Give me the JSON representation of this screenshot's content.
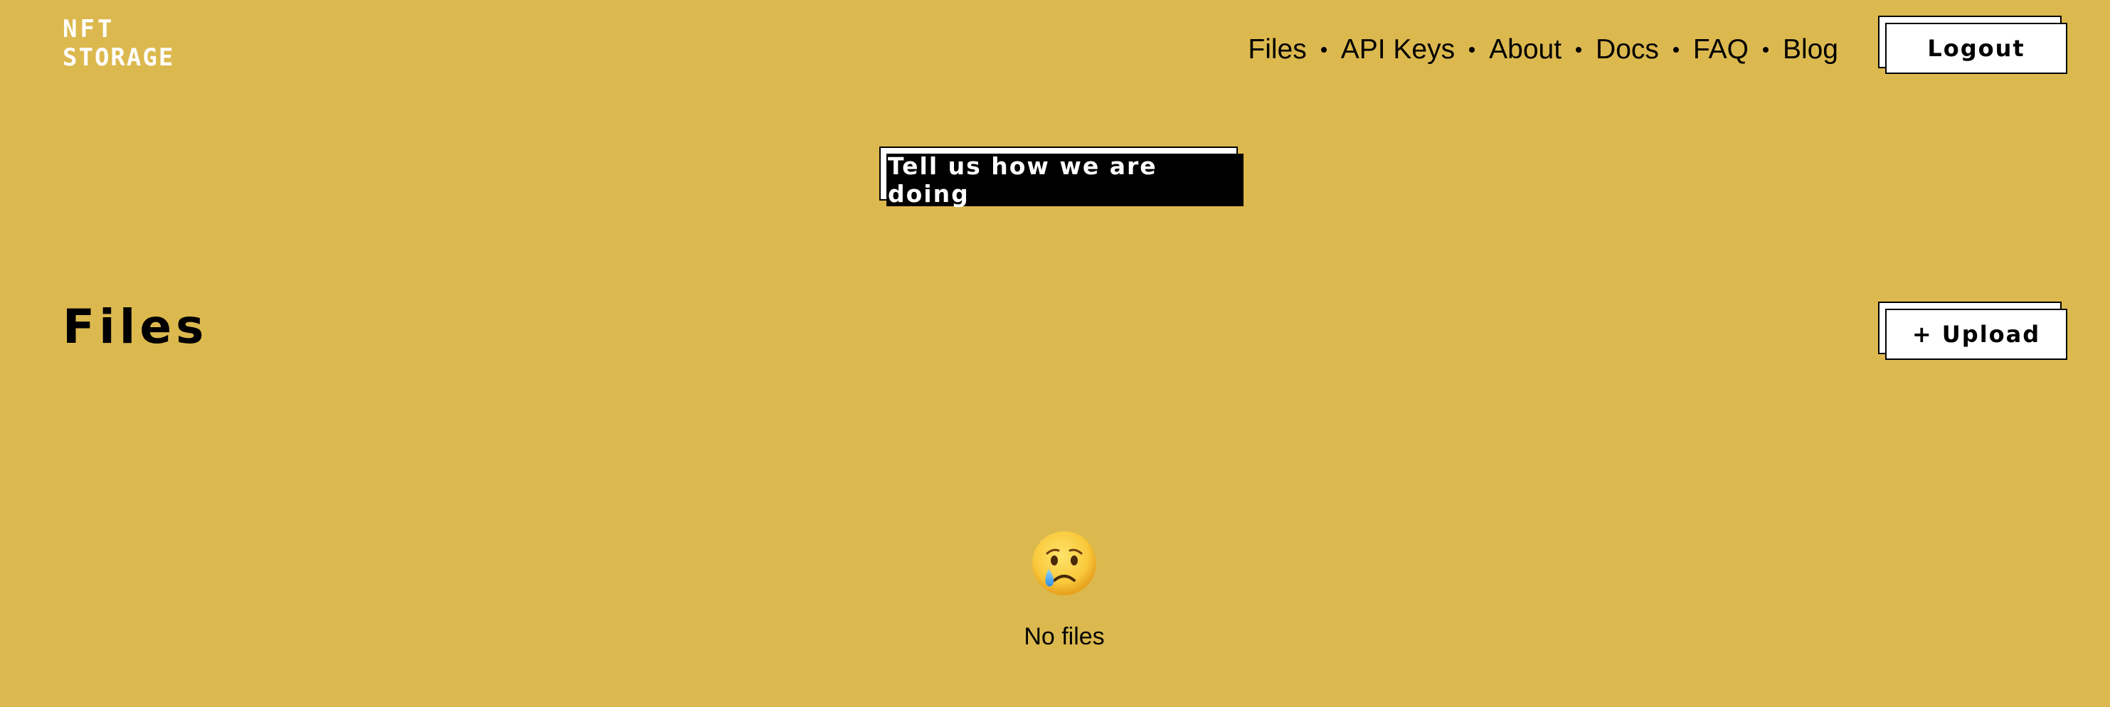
{
  "logo": {
    "line1": "NFT",
    "line2": "STORAGE"
  },
  "nav": {
    "items": [
      "Files",
      "API Keys",
      "About",
      "Docs",
      "FAQ",
      "Blog"
    ]
  },
  "header": {
    "logout_label": "Logout"
  },
  "feedback": {
    "label": "Tell us how we are doing"
  },
  "main": {
    "title": "Files",
    "upload_label": "+ Upload"
  },
  "empty_state": {
    "icon": "crying-face-icon",
    "text": "No files"
  },
  "colors": {
    "background": "#DCB94F",
    "accent": "#000000",
    "button_bg": "#FFFFFF"
  }
}
